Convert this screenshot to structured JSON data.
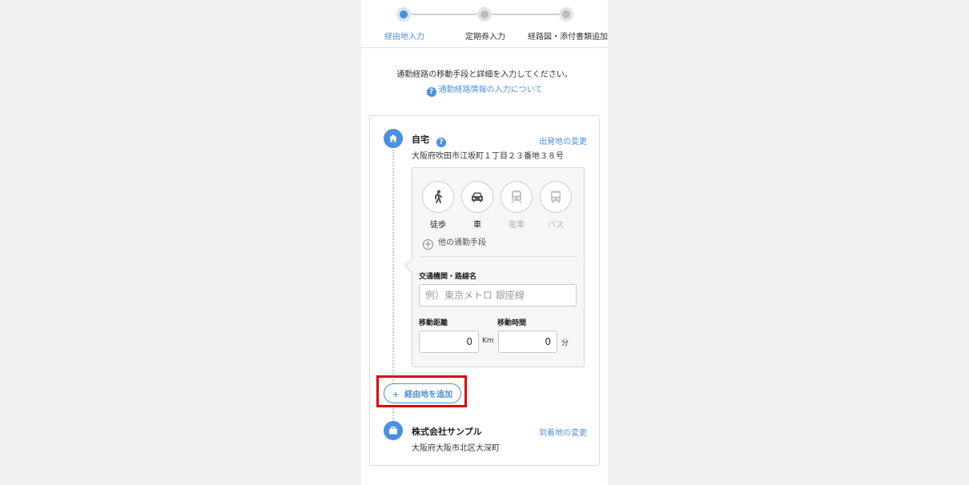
{
  "stepper": {
    "steps": [
      {
        "label": "経由地入力",
        "active": true
      },
      {
        "label": "定期券入力",
        "active": false
      },
      {
        "label": "経路図・添付書類追加",
        "active": false
      }
    ]
  },
  "intro": "通勤経路の移動手段と詳細を入力してください。",
  "help_link": "通勤経路情報の入力について",
  "start": {
    "name": "自宅",
    "address": "大阪府吹田市江坂町１丁目２３番地３８号",
    "change_label": "出発地の変更",
    "icon": "home-icon"
  },
  "modes": [
    {
      "label": "徒歩",
      "icon": "walk-icon",
      "enabled": true
    },
    {
      "label": "車",
      "icon": "car-icon",
      "enabled": true
    },
    {
      "label": "電車",
      "icon": "train-icon",
      "enabled": false
    },
    {
      "label": "バス",
      "icon": "bus-icon",
      "enabled": false
    }
  ],
  "other_mode_label": "他の通勤手段",
  "route_field": {
    "label": "交通機関・路線名",
    "placeholder": "例）東京メトロ 銀座線",
    "value": ""
  },
  "distance_field": {
    "label": "移動距離",
    "value": "0",
    "unit": "Km"
  },
  "time_field": {
    "label": "移動時間",
    "value": "0",
    "unit": "分"
  },
  "add_waypoint_label": "経由地を追加",
  "end": {
    "name": "株式会社サンプル",
    "address": "大阪府大阪市北区大深町",
    "change_label": "到着地の変更",
    "icon": "briefcase-icon"
  },
  "colors": {
    "accent": "#4a90e2",
    "highlight": "#e00000"
  }
}
